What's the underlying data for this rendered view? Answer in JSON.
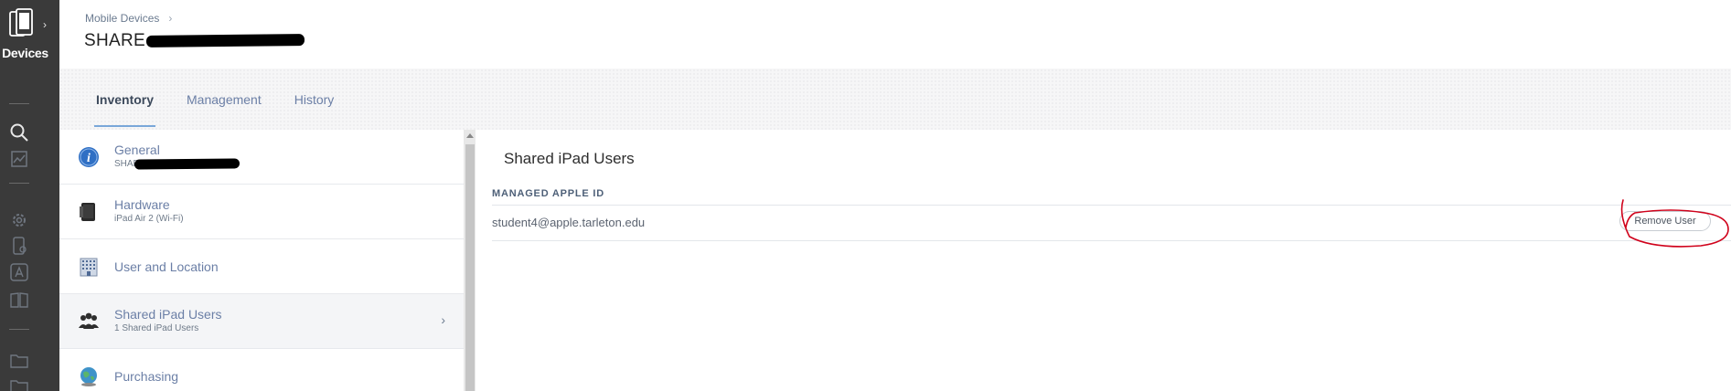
{
  "rail": {
    "section_label": "Devices",
    "icons": [
      "mobile-devices-icon",
      "search-icon",
      "reports-icon",
      "settings-icon",
      "mobile-settings-icon",
      "app-store-icon",
      "books-icon",
      "folder-icon",
      "folder-icon"
    ]
  },
  "header": {
    "breadcrumb": "Mobile Devices",
    "title": "SHARE"
  },
  "tabs": [
    {
      "label": "Inventory",
      "active": true
    },
    {
      "label": "Management",
      "active": false
    },
    {
      "label": "History",
      "active": false
    }
  ],
  "sections": [
    {
      "label": "General",
      "sub": "SHAR",
      "icon": "info-icon"
    },
    {
      "label": "Hardware",
      "sub": "iPad Air 2 (Wi-Fi)",
      "icon": "ipad-icon"
    },
    {
      "label": "User and Location",
      "sub": "",
      "icon": "building-icon"
    },
    {
      "label": "Shared iPad Users",
      "sub": "1 Shared iPad Users",
      "icon": "users-icon",
      "selected": true
    },
    {
      "label": "Purchasing",
      "sub": "",
      "icon": "globe-icon"
    }
  ],
  "content": {
    "title": "Shared iPad Users",
    "column_header": "MANAGED APPLE ID",
    "users": [
      {
        "apple_id": "student4@apple.tarleton.edu",
        "action": "Remove User"
      }
    ]
  },
  "colors": {
    "rail": "#3a3a3a",
    "link": "#6b7fa6",
    "tab_underline": "#7aa7d9",
    "annotation": "#d0021b"
  }
}
